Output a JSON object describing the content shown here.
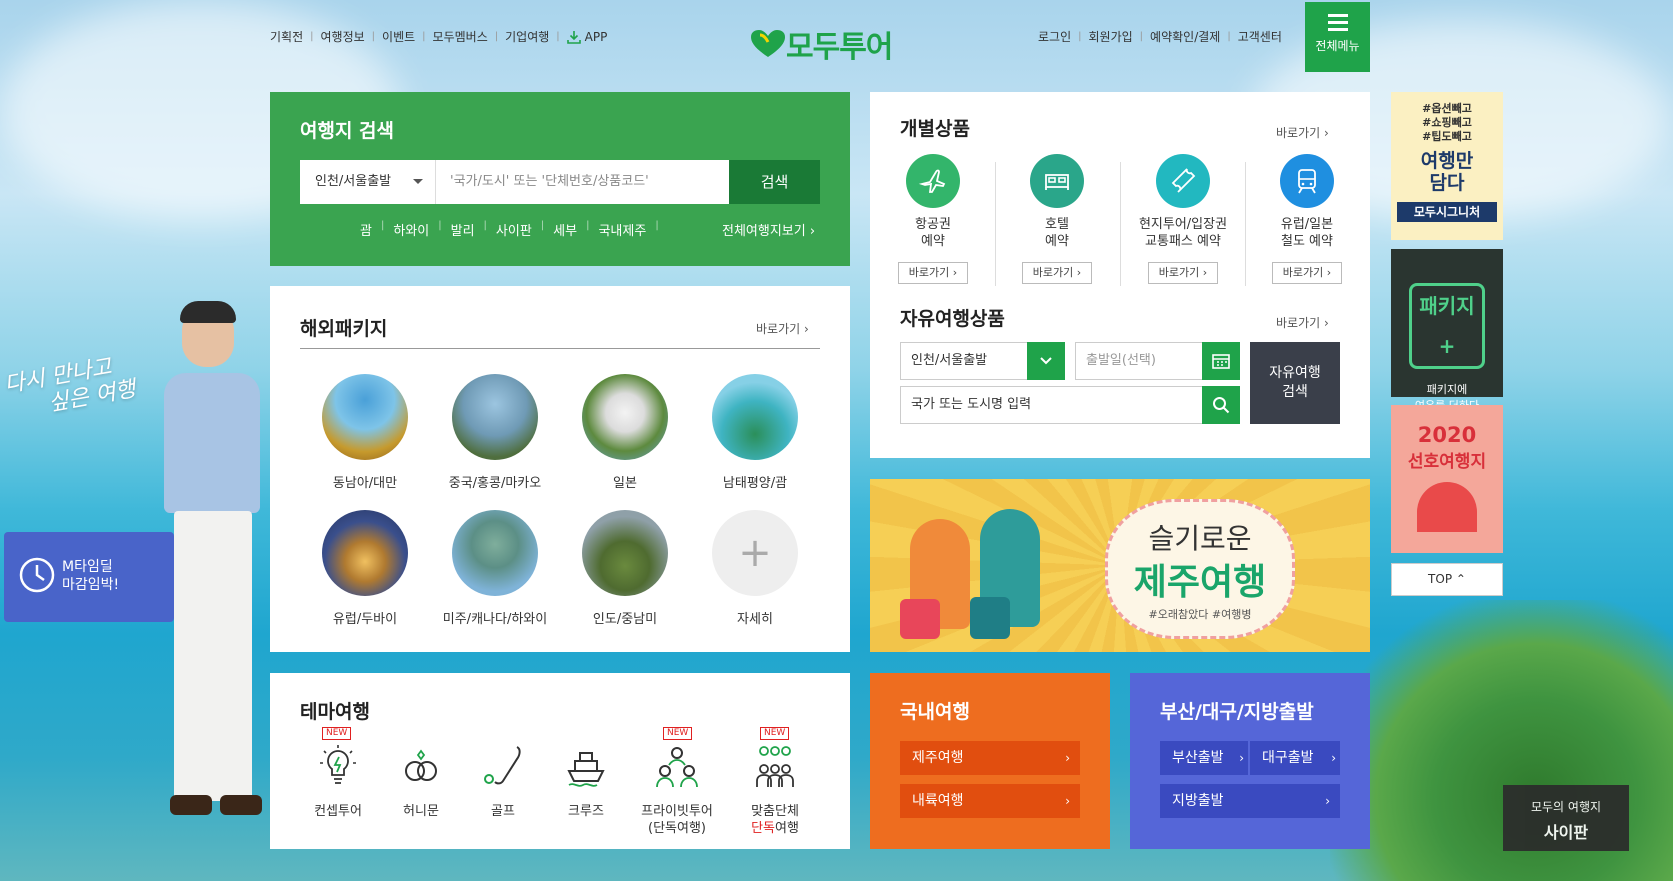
{
  "top_nav": {
    "left": [
      "기획전",
      "여행정보",
      "이벤트",
      "모두멤버스",
      "기업여행"
    ],
    "app": "APP",
    "right": [
      "로그인",
      "회원가입",
      "예약확인/결제",
      "고객센터"
    ],
    "logo": "모두투어",
    "menu": "전체메뉴"
  },
  "search": {
    "title": "여행지 검색",
    "departure": "인천/서울출발",
    "placeholder": "'국가/도시' 또는 '단체번호/상품코드'",
    "button": "검색",
    "quick": [
      "괌",
      "하와이",
      "발리",
      "사이판",
      "세부",
      "국내제주"
    ],
    "all": "전체여행지보기"
  },
  "package": {
    "title": "해외패키지",
    "more": "바로가기",
    "items": [
      "동남아/대만",
      "중국/홍콩/마카오",
      "일본",
      "남태평양/괌",
      "유럽/두바이",
      "미주/캐나다/하와이",
      "인도/중남미",
      "자세히"
    ]
  },
  "theme": {
    "title": "테마여행",
    "items": [
      {
        "l1": "컨셉투어",
        "l2": "",
        "new": "NEW"
      },
      {
        "l1": "허니문",
        "l2": "",
        "new": ""
      },
      {
        "l1": "골프",
        "l2": "",
        "new": ""
      },
      {
        "l1": "크루즈",
        "l2": "",
        "new": ""
      },
      {
        "l1": "프라이빗투어",
        "l2": "(단독여행)",
        "new": "NEW"
      },
      {
        "l1": "맞춤단체",
        "l2a": "단독",
        "l2b": "여행",
        "new": "NEW"
      }
    ]
  },
  "individual": {
    "title": "개별상품",
    "more": "바로가기",
    "items": [
      {
        "l1": "항공권",
        "l2": "예약",
        "btn": "바로가기"
      },
      {
        "l1": "호텔",
        "l2": "예약",
        "btn": "바로가기"
      },
      {
        "l1": "현지투어/입장권",
        "l2": "교통패스 예약",
        "btn": "바로가기"
      },
      {
        "l1": "유럽/일본",
        "l2": "철도 예약",
        "btn": "바로가기"
      }
    ],
    "colors": [
      "#33b56b",
      "#2aa68a",
      "#22b8c0",
      "#1f8fe0"
    ]
  },
  "free": {
    "title": "자유여행상품",
    "more": "바로가기",
    "departure": "인천/서울출발",
    "date_placeholder": "출발일(선택)",
    "dest_placeholder": "국가 또는 도시명 입력",
    "button_l1": "자유여행",
    "button_l2": "검색"
  },
  "jeju_banner": {
    "l1": "슬기로운",
    "l2": "제주여행",
    "tags": "#오래참았다 #여행병"
  },
  "domestic": {
    "title": "국내여행",
    "items": [
      "제주여행",
      "내륙여행"
    ]
  },
  "regional": {
    "title": "부산/대구/지방출발",
    "items": [
      "부산출발",
      "대구출발",
      "지방출발"
    ]
  },
  "side_banners": {
    "b1": [
      "#옵션빼고",
      "#쇼핑빼고",
      "#팁도빼고",
      "여행만",
      "담다",
      "모두시그니처"
    ],
    "b2": [
      "패키지+",
      "패키지에",
      "여유를 더하다"
    ],
    "b3": [
      "2020",
      "선호여행지"
    ],
    "top": "TOP"
  },
  "sitemap": {
    "l1": "모두의 여행지",
    "l2": "사이판"
  },
  "deal": {
    "l1": "M타임딜",
    "l2": "마감임박!"
  },
  "promo_script": [
    "다시 만나고",
    "싶은 여행"
  ]
}
